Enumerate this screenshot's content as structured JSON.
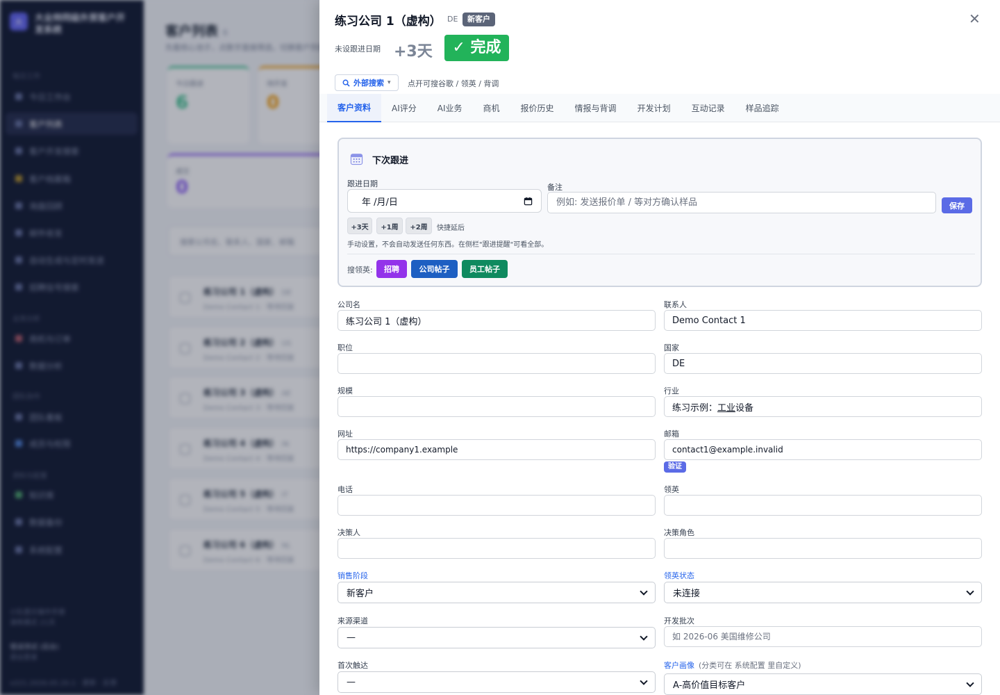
{
  "background": {
    "sidebar": {
      "logo_char": "大",
      "title": "大业帅同级外贸客户开发系统",
      "groups": [
        "每日工作",
        "业务分析",
        "团队协作",
        "资料与配置"
      ],
      "items": [
        "今日工作台",
        "客户列表",
        "客户开发搜索",
        "客户档案箱",
        "询盘回顾",
        "邮件收发",
        "自动生成与定时发送",
        "招聘信号搜索",
        "商机与订单",
        "数据分析",
        "团队看板",
        "成员与权限",
        "知识库",
        "数据备份",
        "系统配置"
      ],
      "footer": [
        "小队提示操作手册",
        "演练模式 21天",
        "错误测试 (后台)",
        "退出登录",
        "v221.2026.05.20.1 · 更新 · 反馈"
      ]
    },
    "main": {
      "title": "客户列表",
      "count": "6",
      "subtitle": "先看核心池子，点数字直接筛选，切换客户列表",
      "stats": [
        {
          "label": "今日跟进",
          "value": "6",
          "color": "#3ec28f"
        },
        {
          "label": "待开发",
          "value": "0",
          "color": "#f59e0b"
        },
        {
          "label": "成交",
          "value": "0",
          "color": "#8b5cf6"
        }
      ],
      "search_placeholder": "搜索公司名、联系人、国家、邮箱",
      "rows": [
        {
          "name": "练习公司 1（虚构）",
          "country": "DE",
          "contact": "Demo Contact 1 · 等待回复"
        },
        {
          "name": "练习公司 2（虚构）",
          "country": "US",
          "contact": "Demo Contact 2 · 等待回复"
        },
        {
          "name": "练习公司 3（虚构）",
          "country": "AE",
          "contact": "Demo Contact 3 · 等待回复"
        },
        {
          "name": "练习公司 4（虚构）",
          "country": "IN",
          "contact": "Demo Contact 4 · 等待回复"
        },
        {
          "name": "练习公司 5（虚构）",
          "country": "IT",
          "contact": "Demo Contact 5 · 等待回复"
        },
        {
          "name": "练习公司 6（虚构）",
          "country": "NL",
          "contact": "Demo Contact 6 · 等待回复"
        }
      ]
    }
  },
  "drawer": {
    "title": "练习公司 1（虚构）",
    "country": "DE",
    "stage_badge": "新客户",
    "close_glyph": "✕",
    "no_followup": "未设跟进日期",
    "plus3": "+3天",
    "done": "✓ 完成",
    "external_search": {
      "label": "外部搜索",
      "caret": "▾",
      "hint": "点开可搜谷歌 / 领英 / 背调"
    },
    "tabs": [
      "客户资料",
      "AI评分",
      "AI业务",
      "商机",
      "报价历史",
      "情报与背调",
      "开发计划",
      "互动记录",
      "样品追踪"
    ],
    "active_tab": 0,
    "followup": {
      "title": "下次跟进",
      "date_label": "跟进日期",
      "date_value": "年 /月/日",
      "note_label": "备注",
      "note_placeholder": "例如: 发送报价单 / 等对方确认样品",
      "save": "保存",
      "quick": [
        "+3天",
        "+1周",
        "+2周"
      ],
      "quick_hint": "快捷延后",
      "manual_note": "手动设置，不会自动发送任何东西。在侧栏\"跟进提醒\"可看全部。",
      "linkedin_label": "搜领英:",
      "linkedin_buttons": [
        {
          "label": "招聘",
          "color": "#9333ea"
        },
        {
          "label": "公司帖子",
          "color": "#1d5fc2"
        },
        {
          "label": "员工帖子",
          "color": "#0f8a5f"
        }
      ]
    },
    "form": {
      "company_label": "公司名",
      "company_value": "练习公司 1（虚构）",
      "contact_label": "联系人",
      "contact_value": "Demo Contact 1",
      "title_label": "职位",
      "title_value": "",
      "country_label": "国家",
      "country_value": "DE",
      "scale_label": "规模",
      "scale_value": "",
      "industry_label": "行业",
      "industry_prefix": "练习示例：",
      "industry_word": "工业",
      "industry_suffix": "设备",
      "website_label": "网址",
      "website_value": "https://company1.example",
      "email_label": "邮箱",
      "email_value": "contact1@example.invalid",
      "verify": "验证",
      "phone_label": "电话",
      "phone_value": "",
      "linkedin_label": "领英",
      "linkedin_value": "",
      "decision_label": "决策人",
      "decision_value": "",
      "role_label": "决策角色",
      "role_value": "",
      "stage_label": "销售阶段",
      "stage_value": "新客户",
      "li_status_label": "领英状态",
      "li_status_value": "未连接",
      "source_label": "来源渠道",
      "source_value": "—",
      "batch_label": "开发批次",
      "batch_placeholder": "如 2026-06 美国维修公司",
      "first_touch_label": "首次触达",
      "first_touch_value": "—",
      "persona_label": "客户画像",
      "persona_hint": "(分类可在 系统配置 里自定义)",
      "persona_value": "A-高价值目标客户"
    }
  }
}
